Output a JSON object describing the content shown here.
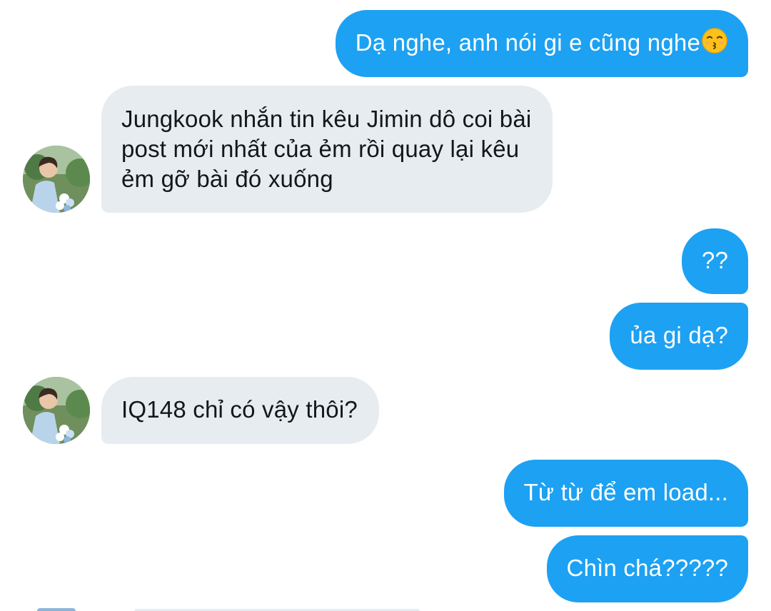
{
  "conversation": {
    "messages": [
      {
        "id": "m1",
        "direction": "outgoing",
        "text": "Dạ nghe, anh nói gi e cũng nghe",
        "emoji": "kissing-face-icon"
      },
      {
        "id": "m2",
        "direction": "incoming",
        "lines": [
          "Jungkook nhắn tin kêu Jimin dô coi bài",
          "post mới nhất của ẻm rồi quay lại kêu",
          "ẻm gỡ bài đó xuống"
        ]
      },
      {
        "id": "m3",
        "direction": "outgoing",
        "text": "??"
      },
      {
        "id": "m4",
        "direction": "outgoing",
        "text": "ủa gi dạ?"
      },
      {
        "id": "m5",
        "direction": "incoming",
        "text": "IQ148 chỉ có vậy thôi?"
      },
      {
        "id": "m6",
        "direction": "outgoing",
        "text": "Từ từ để em load..."
      },
      {
        "id": "m7",
        "direction": "outgoing",
        "text": "Chìn chá?????"
      }
    ]
  },
  "colors": {
    "outgoing_bubble": "#1da1f2",
    "incoming_bubble": "#e6ecf0",
    "background": "#ffffff"
  }
}
